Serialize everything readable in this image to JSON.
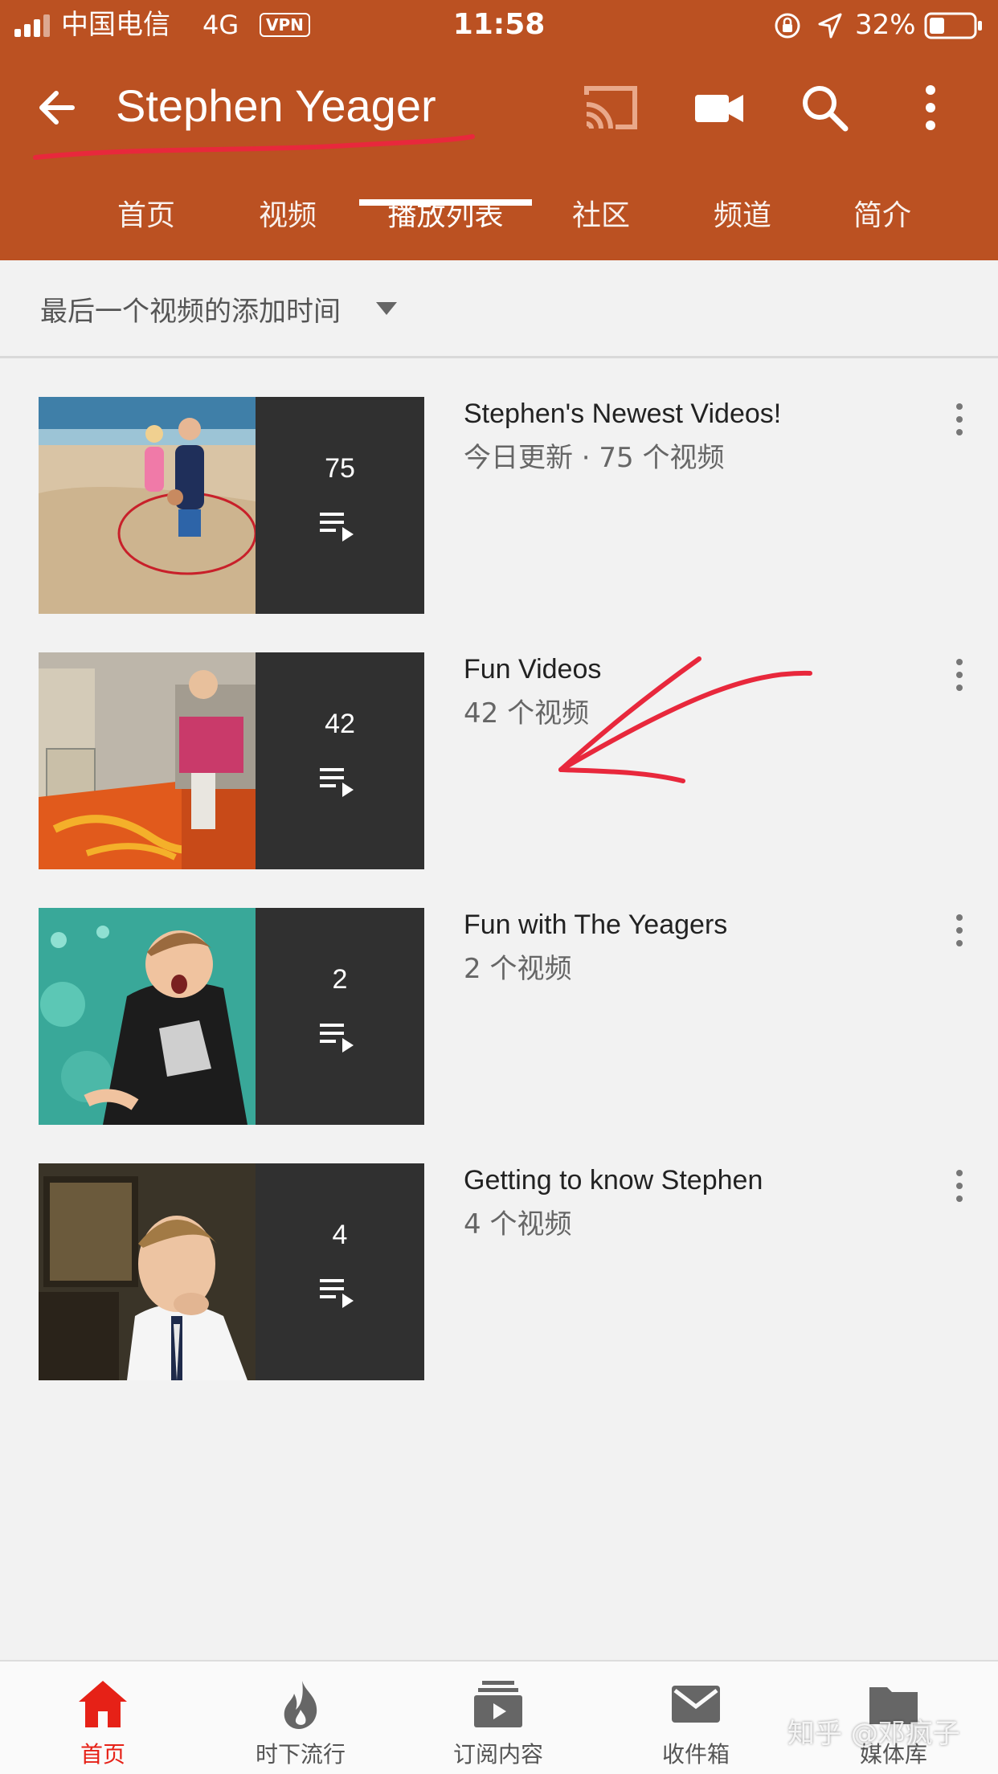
{
  "status_bar": {
    "carrier": "中国电信",
    "network": "4G",
    "vpn": "VPN",
    "time": "11:58",
    "battery": "32%"
  },
  "header": {
    "channel_name": "Stephen Yeager",
    "icons": [
      "back-arrow-icon",
      "cast-icon",
      "video-camera-icon",
      "search-icon",
      "more-vert-icon"
    ]
  },
  "tabs": [
    "首页",
    "视频",
    "播放列表",
    "社区",
    "频道",
    "简介"
  ],
  "active_tab": "播放列表",
  "sort": {
    "label": "最后一个视频的添加时间"
  },
  "playlists": [
    {
      "title": "Stephen's Newest Videos!",
      "meta": "今日更新 · 75 个视频",
      "count": "75"
    },
    {
      "title": "Fun Videos",
      "meta": "42 个视频",
      "count": "42"
    },
    {
      "title": "Fun with The Yeagers",
      "meta": "2 个视频",
      "count": "2"
    },
    {
      "title": "Getting to know Stephen",
      "meta": "4 个视频",
      "count": "4"
    }
  ],
  "bottom_nav": [
    {
      "label": "首页",
      "icon": "home-icon",
      "active": true
    },
    {
      "label": "时下流行",
      "icon": "trending-flame-icon",
      "active": false
    },
    {
      "label": "订阅内容",
      "icon": "subscriptions-icon",
      "active": false
    },
    {
      "label": "收件箱",
      "icon": "inbox-mail-icon",
      "active": false
    },
    {
      "label": "媒体库",
      "icon": "library-folder-icon",
      "active": false
    }
  ],
  "watermark": "知乎 @邓疯子",
  "colors": {
    "brand_bar": "#bb5122",
    "active_nav": "#e62117",
    "annotation": "#e8283c",
    "background": "#f2f2f2"
  }
}
